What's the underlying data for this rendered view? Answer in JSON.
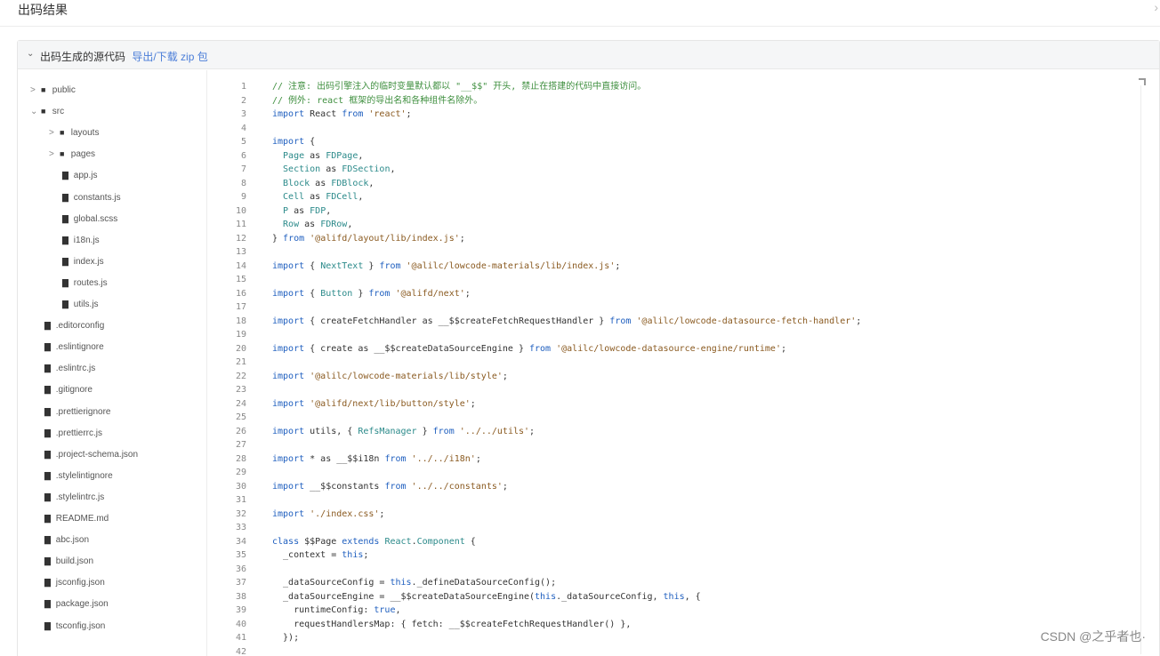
{
  "dialog": {
    "title": "出码结果",
    "close": "›"
  },
  "panel": {
    "chevron": "⌄",
    "title": "出码生成的源代码",
    "link": "导出/下载 zip 包"
  },
  "tree": [
    {
      "label": "public",
      "arrow": ">",
      "icon": "■",
      "depth": 0
    },
    {
      "label": "src",
      "arrow": "⌄",
      "icon": "■",
      "depth": 0
    },
    {
      "label": "layouts",
      "arrow": ">",
      "icon": "■",
      "depth": 1
    },
    {
      "label": "pages",
      "arrow": ">",
      "icon": "■",
      "depth": 1
    },
    {
      "label": "app.js",
      "arrow": "",
      "icon": "▇",
      "depth": 2
    },
    {
      "label": "constants.js",
      "arrow": "",
      "icon": "▇",
      "depth": 2
    },
    {
      "label": "global.scss",
      "arrow": "",
      "icon": "▇",
      "depth": 2
    },
    {
      "label": "i18n.js",
      "arrow": "",
      "icon": "▇",
      "depth": 2
    },
    {
      "label": "index.js",
      "arrow": "",
      "icon": "▇",
      "depth": 2
    },
    {
      "label": "routes.js",
      "arrow": "",
      "icon": "▇",
      "depth": 2
    },
    {
      "label": "utils.js",
      "arrow": "",
      "icon": "▇",
      "depth": 2
    },
    {
      "label": ".editorconfig",
      "arrow": "",
      "icon": "▇",
      "depth": 3
    },
    {
      "label": ".eslintignore",
      "arrow": "",
      "icon": "▇",
      "depth": 3
    },
    {
      "label": ".eslintrc.js",
      "arrow": "",
      "icon": "▇",
      "depth": 3
    },
    {
      "label": ".gitignore",
      "arrow": "",
      "icon": "▇",
      "depth": 3
    },
    {
      "label": ".prettierignore",
      "arrow": "",
      "icon": "▇",
      "depth": 3
    },
    {
      "label": ".prettierrc.js",
      "arrow": "",
      "icon": "▇",
      "depth": 3
    },
    {
      "label": ".project-schema.json",
      "arrow": "",
      "icon": "▇",
      "depth": 3
    },
    {
      "label": ".stylelintignore",
      "arrow": "",
      "icon": "▇",
      "depth": 3
    },
    {
      "label": ".stylelintrc.js",
      "arrow": "",
      "icon": "▇",
      "depth": 3
    },
    {
      "label": "README.md",
      "arrow": "",
      "icon": "▇",
      "depth": 3
    },
    {
      "label": "abc.json",
      "arrow": "",
      "icon": "▇",
      "depth": 3
    },
    {
      "label": "build.json",
      "arrow": "",
      "icon": "▇",
      "depth": 3
    },
    {
      "label": "jsconfig.json",
      "arrow": "",
      "icon": "▇",
      "depth": 3
    },
    {
      "label": "package.json",
      "arrow": "",
      "icon": "▇",
      "depth": 3
    },
    {
      "label": "tsconfig.json",
      "arrow": "",
      "icon": "▇",
      "depth": 3
    }
  ],
  "code": [
    {
      "n": "1",
      "t": [
        [
          "cm",
          "// 注意: 出码引擎注入的临时变量默认都以 \"__$$\" 开头, 禁止在搭建的代码中直接访问。"
        ]
      ]
    },
    {
      "n": "2",
      "t": [
        [
          "cm",
          "// 例外: react 框架的导出名和各种组件名除外。"
        ]
      ]
    },
    {
      "n": "3",
      "t": [
        [
          "kw",
          "import"
        ],
        [
          "",
          " React "
        ],
        [
          "kw",
          "from"
        ],
        [
          "str",
          " 'react'"
        ],
        [
          "",
          ";"
        ]
      ]
    },
    {
      "n": "4",
      "t": []
    },
    {
      "n": "5",
      "t": [
        [
          "kw",
          "import"
        ],
        [
          "",
          " {"
        ]
      ]
    },
    {
      "n": "6",
      "t": [
        [
          "ty",
          "  Page"
        ],
        [
          "",
          " as "
        ],
        [
          "ty",
          "FDPage"
        ],
        [
          "",
          ","
        ]
      ]
    },
    {
      "n": "7",
      "t": [
        [
          "ty",
          "  Section"
        ],
        [
          "",
          " as "
        ],
        [
          "ty",
          "FDSection"
        ],
        [
          "",
          ","
        ]
      ]
    },
    {
      "n": "8",
      "t": [
        [
          "ty",
          "  Block"
        ],
        [
          "",
          " as "
        ],
        [
          "ty",
          "FDBlock"
        ],
        [
          "",
          ","
        ]
      ]
    },
    {
      "n": "9",
      "t": [
        [
          "ty",
          "  Cell"
        ],
        [
          "",
          " as "
        ],
        [
          "ty",
          "FDCell"
        ],
        [
          "",
          ","
        ]
      ]
    },
    {
      "n": "10",
      "t": [
        [
          "ty",
          "  P"
        ],
        [
          "",
          " as "
        ],
        [
          "ty",
          "FDP"
        ],
        [
          "",
          ","
        ]
      ]
    },
    {
      "n": "11",
      "t": [
        [
          "ty",
          "  Row"
        ],
        [
          "",
          " as "
        ],
        [
          "ty",
          "FDRow"
        ],
        [
          "",
          ","
        ]
      ]
    },
    {
      "n": "12",
      "t": [
        [
          "",
          "} "
        ],
        [
          "kw",
          "from"
        ],
        [
          "str",
          " '@alifd/layout/lib/index.js'"
        ],
        [
          "",
          ";"
        ]
      ]
    },
    {
      "n": "13",
      "t": []
    },
    {
      "n": "14",
      "t": [
        [
          "kw",
          "import"
        ],
        [
          "",
          " { "
        ],
        [
          "ty",
          "NextText"
        ],
        [
          "",
          " } "
        ],
        [
          "kw",
          "from"
        ],
        [
          "str",
          " '@alilc/lowcode-materials/lib/index.js'"
        ],
        [
          "",
          ";"
        ]
      ]
    },
    {
      "n": "15",
      "t": []
    },
    {
      "n": "16",
      "t": [
        [
          "kw",
          "import"
        ],
        [
          "",
          " { "
        ],
        [
          "ty",
          "Button"
        ],
        [
          "",
          " } "
        ],
        [
          "kw",
          "from"
        ],
        [
          "str",
          " '@alifd/next'"
        ],
        [
          "",
          ";"
        ]
      ]
    },
    {
      "n": "17",
      "t": []
    },
    {
      "n": "18",
      "t": [
        [
          "kw",
          "import"
        ],
        [
          "",
          " { createFetchHandler as __$$createFetchRequestHandler } "
        ],
        [
          "kw",
          "from"
        ],
        [
          "str",
          " '@alilc/lowcode-datasource-fetch-handler'"
        ],
        [
          "",
          ";"
        ]
      ]
    },
    {
      "n": "19",
      "t": []
    },
    {
      "n": "20",
      "t": [
        [
          "kw",
          "import"
        ],
        [
          "",
          " { create as __$$createDataSourceEngine } "
        ],
        [
          "kw",
          "from"
        ],
        [
          "str",
          " '@alilc/lowcode-datasource-engine/runtime'"
        ],
        [
          "",
          ";"
        ]
      ]
    },
    {
      "n": "21",
      "t": []
    },
    {
      "n": "22",
      "t": [
        [
          "kw",
          "import"
        ],
        [
          "str",
          " '@alilc/lowcode-materials/lib/style'"
        ],
        [
          "",
          ";"
        ]
      ]
    },
    {
      "n": "23",
      "t": []
    },
    {
      "n": "24",
      "t": [
        [
          "kw",
          "import"
        ],
        [
          "str",
          " '@alifd/next/lib/button/style'"
        ],
        [
          "",
          ";"
        ]
      ]
    },
    {
      "n": "25",
      "t": []
    },
    {
      "n": "26",
      "t": [
        [
          "kw",
          "import"
        ],
        [
          "",
          " utils, { "
        ],
        [
          "ty",
          "RefsManager"
        ],
        [
          "",
          " } "
        ],
        [
          "kw",
          "from"
        ],
        [
          "str",
          " '../../utils'"
        ],
        [
          "",
          ";"
        ]
      ]
    },
    {
      "n": "27",
      "t": []
    },
    {
      "n": "28",
      "t": [
        [
          "kw",
          "import"
        ],
        [
          "",
          " * as __$$i18n "
        ],
        [
          "kw",
          "from"
        ],
        [
          "str",
          " '../../i18n'"
        ],
        [
          "",
          ";"
        ]
      ]
    },
    {
      "n": "29",
      "t": []
    },
    {
      "n": "30",
      "t": [
        [
          "kw",
          "import"
        ],
        [
          "",
          " __$$constants "
        ],
        [
          "kw",
          "from"
        ],
        [
          "str",
          " '../../constants'"
        ],
        [
          "",
          ";"
        ]
      ]
    },
    {
      "n": "31",
      "t": []
    },
    {
      "n": "32",
      "t": [
        [
          "kw",
          "import"
        ],
        [
          "str",
          " './index.css'"
        ],
        [
          "",
          ";"
        ]
      ]
    },
    {
      "n": "33",
      "t": []
    },
    {
      "n": "34",
      "t": [
        [
          "kw",
          "class"
        ],
        [
          "",
          " $$Page "
        ],
        [
          "kw",
          "extends"
        ],
        [
          "ty",
          " React"
        ],
        [
          "",
          "."
        ],
        [
          "ty",
          "Component"
        ],
        [
          "",
          " {"
        ]
      ]
    },
    {
      "n": "35",
      "t": [
        [
          "",
          "  _context = "
        ],
        [
          "kw",
          "this"
        ],
        [
          "",
          ";"
        ]
      ]
    },
    {
      "n": "36",
      "t": []
    },
    {
      "n": "37",
      "t": [
        [
          "",
          "  _dataSourceConfig = "
        ],
        [
          "kw",
          "this"
        ],
        [
          "",
          "._defineDataSourceConfig();"
        ]
      ]
    },
    {
      "n": "38",
      "t": [
        [
          "",
          "  _dataSourceEngine = __$$createDataSourceEngine("
        ],
        [
          "kw",
          "this"
        ],
        [
          "",
          "._dataSourceConfig, "
        ],
        [
          "kw",
          "this"
        ],
        [
          "",
          ", {"
        ]
      ]
    },
    {
      "n": "39",
      "t": [
        [
          "",
          "    runtimeConfig: "
        ],
        [
          "kw",
          "true"
        ],
        [
          "",
          ","
        ]
      ]
    },
    {
      "n": "40",
      "t": [
        [
          "",
          "    requestHandlersMap: { fetch: __$$createFetchRequestHandler() },"
        ]
      ]
    },
    {
      "n": "41",
      "t": [
        [
          "",
          "  });"
        ]
      ]
    },
    {
      "n": "42",
      "t": []
    }
  ],
  "watermark": "CSDN @之乎者也·"
}
